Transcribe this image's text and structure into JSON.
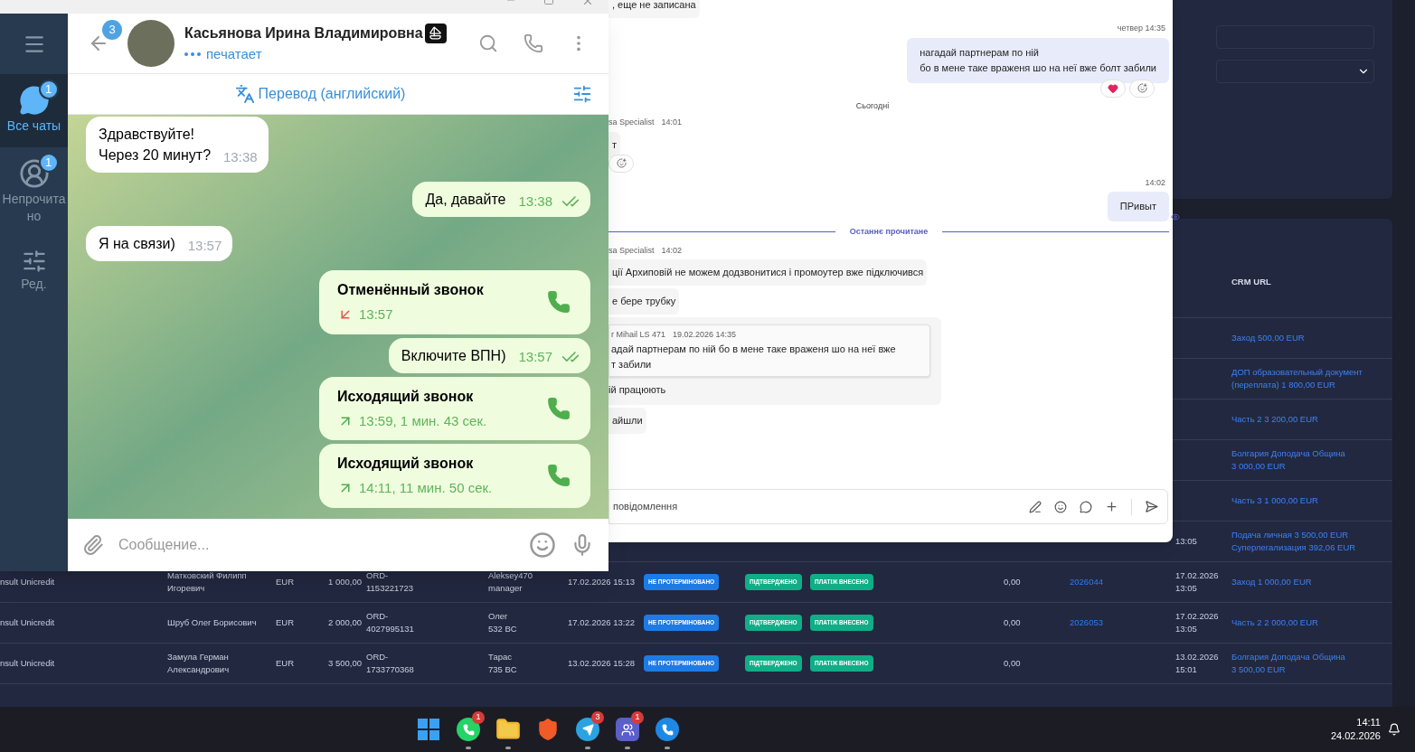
{
  "crm": {
    "table": {
      "columns": [
        {
          "label": "CRM URL"
        }
      ],
      "rows": [
        {
          "crm": [
            "Заход 500,00 EUR"
          ]
        },
        {
          "crm": [
            "ДОП образовательный документ",
            "(переплата) 1 800,00 EUR"
          ]
        },
        {
          "crm": [
            "Часть 2 3 200,00 EUR"
          ]
        },
        {
          "crm": [
            "Болгария Доподача Община",
            "3 000,00 EUR"
          ]
        },
        {
          "crm": [
            "Часть 3 1 000,00 EUR"
          ]
        },
        {
          "date2": [
            "13:05"
          ],
          "crm": [
            "Подача личная 3 500,00 EUR",
            "Суперлегализация 392,06 EUR"
          ]
        },
        {
          "client": "nsult Unicredit",
          "name": [
            "Матковский Филипп",
            "Игоревич"
          ],
          "currency": "EUR",
          "amount": "1 000,00",
          "order": [
            "ORD-",
            "1153221723"
          ],
          "manager": [
            "Aleksey470",
            "manager"
          ],
          "date": "17.02.2026 15:13",
          "badges": [
            {
              "label": "НЕ ПРОТЕРМІНОВАНО",
              "color": "#1d7be6"
            },
            {
              "label": "ПІДТВЕРДЖЕНО",
              "color": "#0fae86"
            },
            {
              "label": "ПЛАТІЖ ВНЕСЕНО",
              "color": "#0fae86"
            }
          ],
          "value": "0,00",
          "id": "2026044",
          "date2": [
            "17.02.2026",
            "13:05"
          ],
          "crm": [
            "Заход 1 000,00 EUR"
          ]
        },
        {
          "client": "nsult Unicredit",
          "name": [
            "Шруб Олег Борисович"
          ],
          "currency": "EUR",
          "amount": "2 000,00",
          "order": [
            "ORD-",
            "4027995131"
          ],
          "manager": [
            "Олег",
            "532 BC"
          ],
          "date": "17.02.2026 13:22",
          "badges": [
            {
              "label": "НЕ ПРОТЕРМІНОВАНО",
              "color": "#1d7be6"
            },
            {
              "label": "ПІДТВЕРДЖЕНО",
              "color": "#0fae86"
            },
            {
              "label": "ПЛАТІЖ ВНЕСЕНО",
              "color": "#0fae86"
            }
          ],
          "value": "0,00",
          "id": "2026053",
          "date2": [
            "17.02.2026",
            "13:05"
          ],
          "crm": [
            "Часть 2 2 000,00 EUR"
          ]
        },
        {
          "client": "nsult Unicredit",
          "name": [
            "Замула Герман",
            "Александрович"
          ],
          "currency": "EUR",
          "amount": "3 500,00",
          "order": [
            "ORD-",
            "1733770368"
          ],
          "manager": [
            "Тарас",
            "735 BC"
          ],
          "date": "13.02.2026 15:28",
          "badges": [
            {
              "label": "НЕ ПРОТЕРМІНОВАНО",
              "color": "#1d7be6"
            },
            {
              "label": "ПІДТВЕРДЖЕНО",
              "color": "#0fae86"
            },
            {
              "label": "ПЛАТІЖ ВНЕСЕНО",
              "color": "#0fae86"
            }
          ],
          "value": "0,00",
          "date2": [
            "13.02.2026",
            "15:01"
          ],
          "crm": [
            "Болгария Доподача Община",
            "3 500,00 EUR"
          ]
        }
      ]
    }
  },
  "teams": {
    "items": [
      {
        "kind": "incoming",
        "lines": [
          ", еще не записана"
        ]
      },
      {
        "kind": "stamp",
        "text": "четвер 14:35"
      },
      {
        "kind": "outgoing",
        "lines": [
          "нагадай партнерам по ній",
          "бо в  мене таке враженя шо на неї вже болт забили"
        ],
        "seen": false,
        "reactions": {
          "heart": true
        }
      },
      {
        "kind": "day",
        "text": "Сьогодні"
      },
      {
        "kind": "sender",
        "name": "sa Specialist",
        "time": "14:01"
      },
      {
        "kind": "incoming",
        "lines": [
          "т"
        ],
        "reactions": {
          "heart": false
        }
      },
      {
        "kind": "stamp",
        "text": "14:02"
      },
      {
        "kind": "outgoing",
        "lines": [
          "ПРивыт"
        ],
        "seen": true
      },
      {
        "kind": "divider",
        "text": "Останнє прочитане"
      },
      {
        "kind": "sender",
        "name": "sa Specialist",
        "time": "14:02"
      },
      {
        "kind": "incoming",
        "lines": [
          "ції Архиповій не можем додзвонитися і промоутер вже підключився"
        ]
      },
      {
        "kind": "incoming",
        "lines": [
          "е бере трубку"
        ]
      },
      {
        "kind": "quote",
        "author": "r Mihail LS 471",
        "time": "19.02.2026 14:35",
        "quote_lines": [
          "адай партнерам по ній бо в мене таке враженя шо на неї вже",
          "т забили"
        ],
        "lines": [
          "ій працюють"
        ]
      },
      {
        "kind": "incoming",
        "lines": [
          "айшли"
        ]
      }
    ],
    "composer": {
      "placeholder": "повідомлення"
    }
  },
  "telegram": {
    "sidebar": [
      {
        "kind": "chats",
        "label": "Все чаты",
        "badge": "1",
        "selected": true
      },
      {
        "kind": "unread",
        "label": "Непрочитано",
        "badge": "1",
        "selected": false
      },
      {
        "kind": "edit",
        "label": "Ред.",
        "selected": false
      }
    ],
    "header": {
      "back_badge": "3",
      "name": "Касьянова Ирина Владимировна",
      "status": "печатает"
    },
    "translate": "Перевод (английский)",
    "messages": [
      {
        "kind": "text",
        "outgoing": false,
        "lines": [
          "Здравствуйте!",
          "Через 20 минут?"
        ],
        "time": "13:38"
      },
      {
        "kind": "text",
        "outgoing": true,
        "lines": [
          "Да, давайте"
        ],
        "time": "13:38",
        "read": true
      },
      {
        "kind": "text",
        "outgoing": false,
        "lines": [
          "Я на связи)"
        ],
        "time": "13:57"
      },
      {
        "kind": "call",
        "outgoing": true,
        "title": "Отменённый звонок",
        "detail": "13:57",
        "missed": true
      },
      {
        "kind": "text",
        "outgoing": true,
        "lines": [
          "Включите ВПН)"
        ],
        "time": "13:57",
        "read": true
      },
      {
        "kind": "call",
        "outgoing": true,
        "title": "Исходящий звонок",
        "detail": "13:59, 1 мин. 43 сек.",
        "missed": false
      },
      {
        "kind": "call",
        "outgoing": true,
        "title": "Исходящий звонок",
        "detail": "14:11, 11 мин. 50 сек.",
        "missed": false
      }
    ],
    "composer": {
      "placeholder": "Сообщение..."
    }
  },
  "taskbar": {
    "apps": [
      {
        "kind": "start"
      },
      {
        "kind": "whatsapp",
        "badge": "1",
        "running": true
      },
      {
        "kind": "files",
        "running": true
      },
      {
        "kind": "brave",
        "running": false
      },
      {
        "kind": "telegram",
        "badge": "3",
        "running": true
      },
      {
        "kind": "teams",
        "badge": "1",
        "running": true
      },
      {
        "kind": "phone",
        "running": true
      }
    ],
    "time": "14:11",
    "date": "24.02.2026"
  }
}
